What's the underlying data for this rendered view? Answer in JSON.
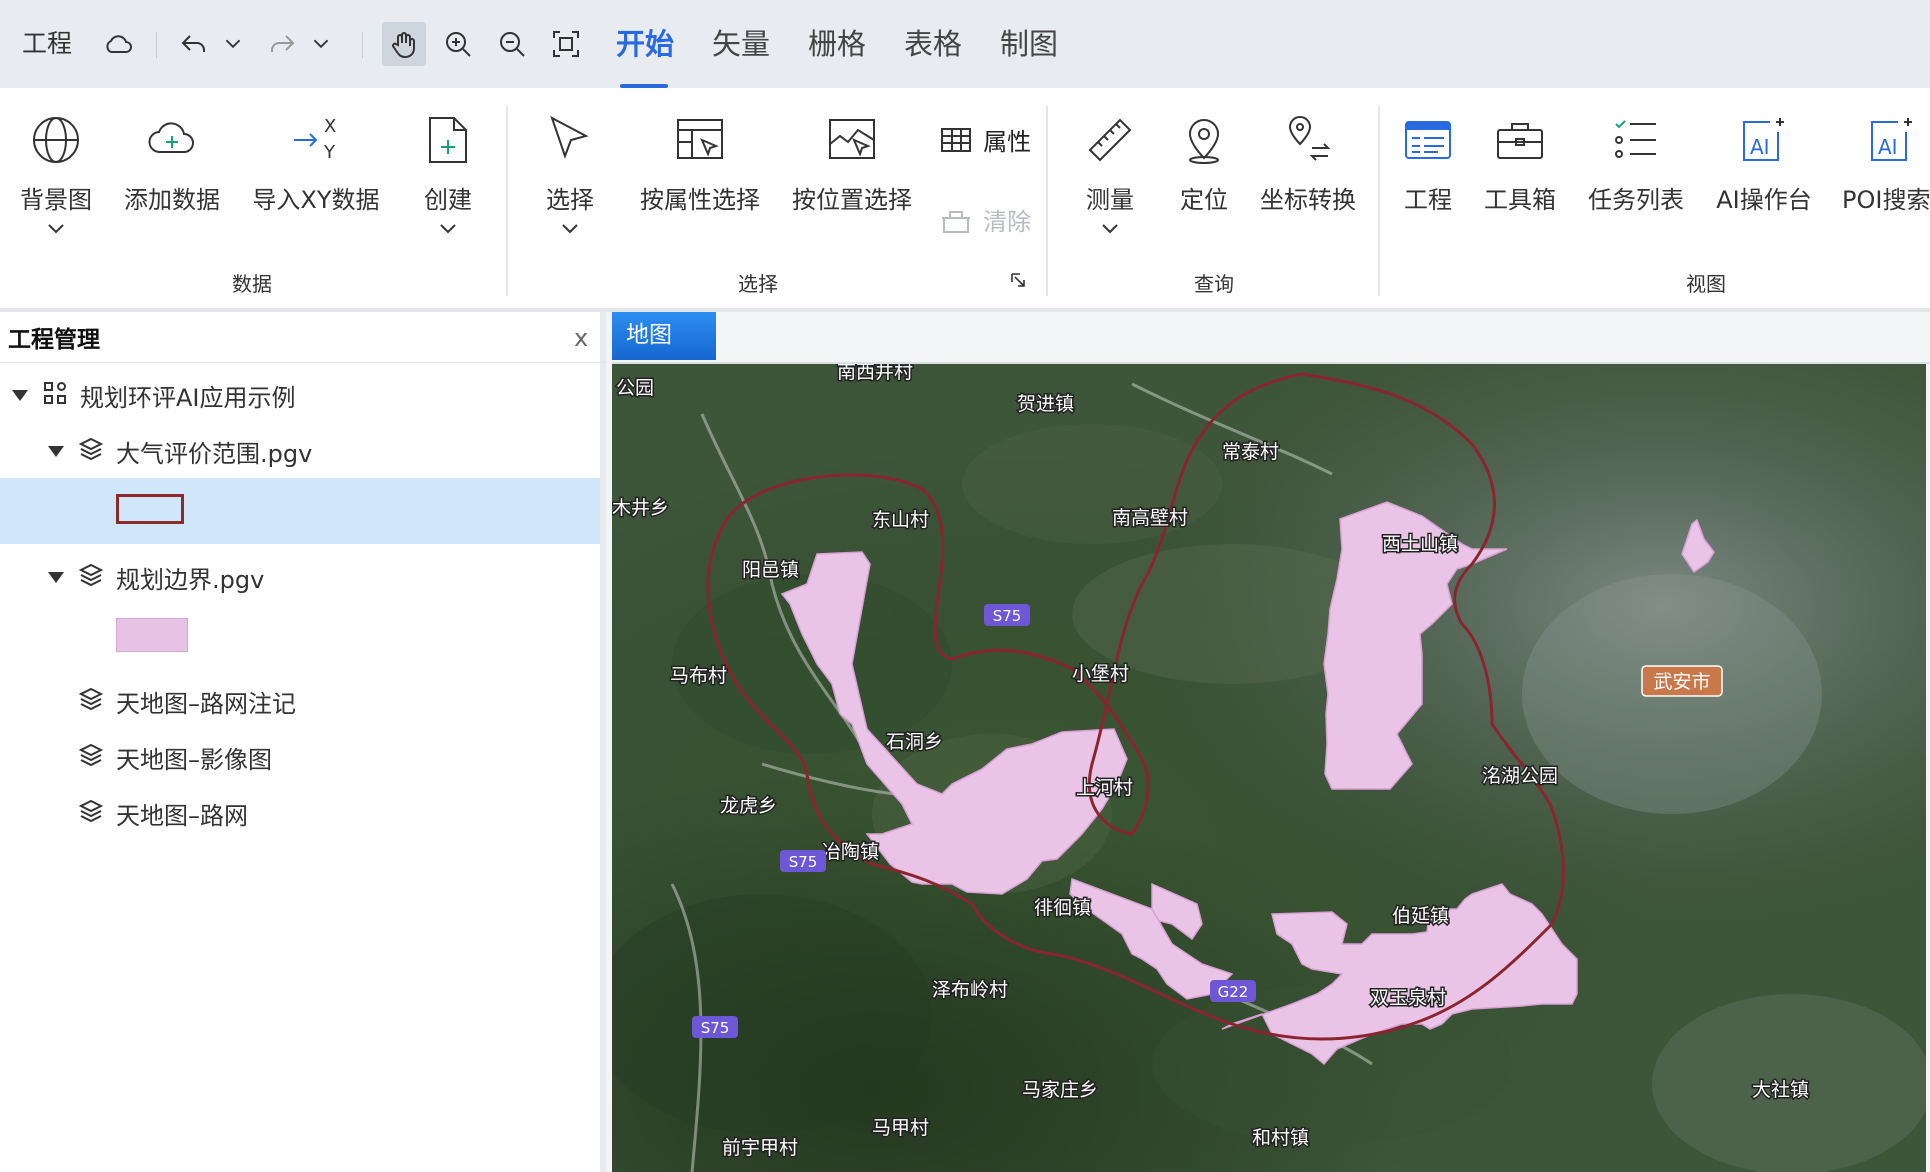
{
  "menubar": {
    "project": "工程",
    "tabs": [
      {
        "label": "开始",
        "active": true
      },
      {
        "label": "矢量",
        "active": false
      },
      {
        "label": "栅格",
        "active": false
      },
      {
        "label": "表格",
        "active": false
      },
      {
        "label": "制图",
        "active": false
      }
    ],
    "accent": "#2a6ae0"
  },
  "ribbon": {
    "data_group": {
      "label": "数据",
      "buttons": [
        "背景图",
        "添加数据",
        "导入XY数据",
        "创建"
      ]
    },
    "select_group": {
      "label": "选择",
      "buttons": [
        "选择",
        "按属性选择",
        "按位置选择"
      ],
      "attr": "属性",
      "clear": "清除"
    },
    "query_group": {
      "label": "查询",
      "buttons": [
        "测量",
        "定位",
        "坐标转换"
      ]
    },
    "view_group": {
      "label": "视图",
      "buttons": [
        "工程",
        "工具箱",
        "任务列表",
        "AI操作台",
        "POI搜索"
      ]
    }
  },
  "panel": {
    "title": "工程管理",
    "close": "x",
    "tree": {
      "root": "规划环评AI应用示例",
      "layers": [
        "大气评价范围.pgv",
        "规划边界.pgv",
        "天地图–路网注记",
        "天地图–影像图",
        "天地图–路网"
      ]
    },
    "swatch_colors": {
      "outline": "#8b2a2a",
      "fill": "#e6c3e4"
    }
  },
  "map": {
    "tab": "地图",
    "labels": [
      "南西井村",
      "贺进镇",
      "常泰村",
      "南高壁村",
      "东山村",
      "西土山镇",
      "阳邑镇",
      "马布村",
      "小堡村",
      "武安市",
      "石洞乡",
      "上河村",
      "洺湖公园",
      "龙虎乡",
      "冶陶镇",
      "徘徊镇",
      "伯延镇",
      "泽布岭村",
      "双玉泉村",
      "马家庄乡",
      "马甲村",
      "前宇甲村",
      "和村镇",
      "大社镇",
      "木井乡",
      "公园"
    ],
    "road_badges": [
      "S75",
      "S75",
      "S75",
      "G22"
    ],
    "colors": {
      "boundary": "#8a2530",
      "plan_fill": "#e9c4e6",
      "badge": "#6e57d6",
      "city_badge": "#c8784a"
    }
  }
}
